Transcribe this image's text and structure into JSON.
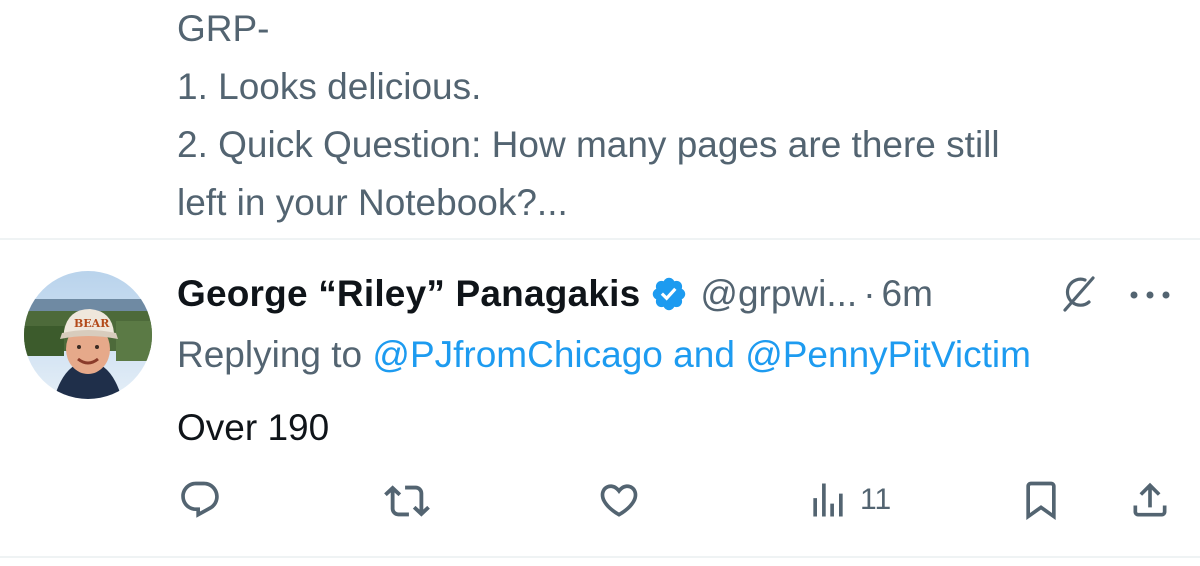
{
  "previous_tweet": {
    "lines": [
      "GRP-",
      "1. Looks delicious.",
      "2. Quick Question: How many pages are there still",
      "left in your Notebook?..."
    ]
  },
  "tweet": {
    "display_name": "George “Riley” Panagakis",
    "handle": "@grpwi...",
    "separator": "·",
    "time": "6m",
    "replying_prefix": "Replying to",
    "replying_mention_1": "@PJfromChicago",
    "replying_and": "and",
    "replying_mention_2": "@PennyPitVictim",
    "body": "Over 190",
    "views_count": "11"
  },
  "icons": {
    "verified": "verified-badge-icon",
    "grok": "grok-icon",
    "more": "more-options-icon",
    "reply": "reply-icon",
    "retweet": "retweet-icon",
    "like": "heart-icon",
    "views": "views-icon",
    "bookmark": "bookmark-icon",
    "share": "share-icon"
  },
  "colors": {
    "text_primary": "#0f1419",
    "text_secondary": "#536471",
    "accent": "#1d9bf0",
    "divider": "#eff3f4"
  }
}
